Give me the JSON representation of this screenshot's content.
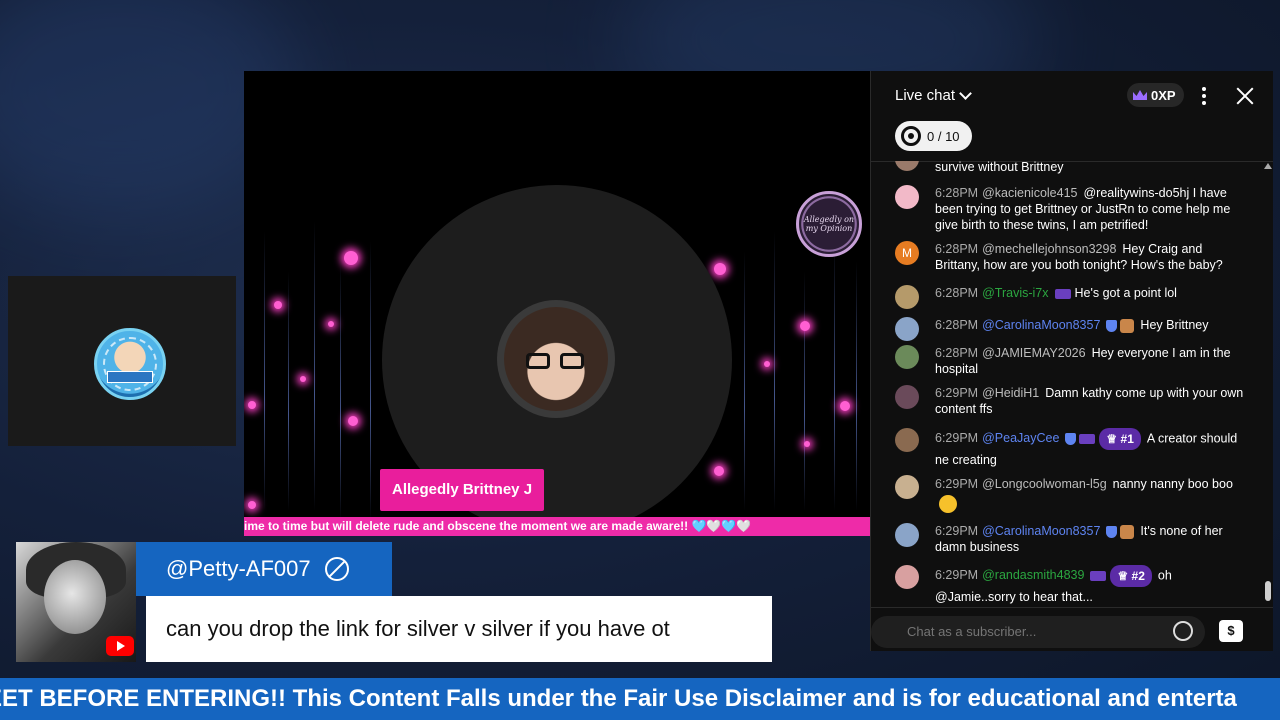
{
  "video": {
    "presenter_name": "Allegedly Brittney J",
    "pink_ticker": "ime to time but will delete rude and obscene the moment we are made aware!! 🩵🤍🩵🤍",
    "brand_badge_text": "Allegedly on my Opinion"
  },
  "comment": {
    "username": "@Petty-AF007",
    "text": "can you drop the link for silver v silver if you have ot"
  },
  "bottom_ticker": "EET BEFORE ENTERING!! This Content Falls under the Fair Use Disclaimer and is for educational and enterta",
  "chat": {
    "title": "Live chat",
    "xp": "0XP",
    "goal": "0 / 10",
    "input_placeholder": "Chat as a subscriber...",
    "superchat_icon": "$",
    "messages": [
      {
        "time": "",
        "author": "",
        "text": "survive without Brittney",
        "avatar_color": "#9a7a6a"
      },
      {
        "time": "6:28PM",
        "author": "@kacienicole415",
        "text": "@realitywins-do5hj I have been trying to get Brittney or JustRn to come help me give birth to these twins, I am petrified!",
        "avatar_color": "#f2b9c8"
      },
      {
        "time": "6:28PM",
        "author": "@mechellejohnson3298",
        "text": "Hey Craig and Brittany, how are you both tonight? How's the baby?",
        "avatar_color": "#e67c22",
        "avatar_letter": "M"
      },
      {
        "time": "6:28PM",
        "author": "@Travis-i7x",
        "text": "He's got a point lol",
        "avatar_color": "#b59a6a"
      },
      {
        "time": "6:28PM",
        "author": "@CarolinaMoon8357",
        "text": "Hey Brittney",
        "avatar_color": "#8aa4c8"
      },
      {
        "time": "6:28PM",
        "author": "@JAMIEMAY2026",
        "text": "Hey everyone I am in the hospital",
        "avatar_color": "#6b8a5a"
      },
      {
        "time": "6:29PM",
        "author": "@HeidiH1",
        "text": "Damn kathy come up with your own content ffs",
        "avatar_color": "#6a4a5a"
      },
      {
        "time": "6:29PM",
        "author": "@PeaJayCee",
        "rank": "#1",
        "text": "A creator should ne creating",
        "avatar_color": "#8a6a50"
      },
      {
        "time": "6:29PM",
        "author": "@Longcoolwoman-l5g",
        "text": "nanny nanny boo boo",
        "avatar_color": "#c8b090"
      },
      {
        "time": "6:29PM",
        "author": "@CarolinaMoon8357",
        "text": "It's none of her damn business",
        "avatar_color": "#8aa4c8"
      },
      {
        "time": "6:29PM",
        "author": "@randasmith4839",
        "rank": "#2",
        "text": "oh @Jamie..sorry to hear that...",
        "avatar_color": "#d8a0a0"
      }
    ]
  }
}
